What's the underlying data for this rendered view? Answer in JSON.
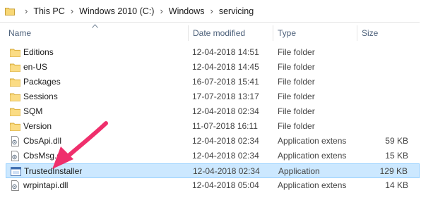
{
  "address": {
    "crumbs": [
      "This PC",
      "Windows 2010 (C:)",
      "Windows",
      "servicing"
    ]
  },
  "columns": {
    "name": "Name",
    "date": "Date modified",
    "type": "Type",
    "size": "Size"
  },
  "files": [
    {
      "name": "Editions",
      "date": "12-04-2018 14:51",
      "type": "File folder",
      "size": "",
      "icon": "folder-icon"
    },
    {
      "name": "en-US",
      "date": "12-04-2018 14:45",
      "type": "File folder",
      "size": "",
      "icon": "folder-icon"
    },
    {
      "name": "Packages",
      "date": "16-07-2018 15:41",
      "type": "File folder",
      "size": "",
      "icon": "folder-icon"
    },
    {
      "name": "Sessions",
      "date": "17-07-2018 13:17",
      "type": "File folder",
      "size": "",
      "icon": "folder-icon"
    },
    {
      "name": "SQM",
      "date": "12-04-2018 02:34",
      "type": "File folder",
      "size": "",
      "icon": "folder-icon"
    },
    {
      "name": "Version",
      "date": "11-07-2018 16:11",
      "type": "File folder",
      "size": "",
      "icon": "folder-icon"
    },
    {
      "name": "CbsApi.dll",
      "date": "12-04-2018 02:34",
      "type": "Application extens",
      "size": "59 KB",
      "icon": "dll-file-icon"
    },
    {
      "name": "CbsMsg.dll",
      "date": "12-04-2018 02:34",
      "type": "Application extens",
      "size": "15 KB",
      "icon": "dll-file-icon"
    },
    {
      "name": "TrustedInstaller",
      "date": "12-04-2018 02:34",
      "type": "Application",
      "size": "129 KB",
      "icon": "application-icon",
      "selected": true
    },
    {
      "name": "wrpintapi.dll",
      "date": "12-04-2018 05:04",
      "type": "Application extens",
      "size": "14 KB",
      "icon": "dll-file-icon"
    }
  ],
  "colors": {
    "selection_fill": "#cce8ff",
    "selection_border": "#99d1ff",
    "folder": "#f4c35a",
    "arrow": "#ef2f6c"
  }
}
